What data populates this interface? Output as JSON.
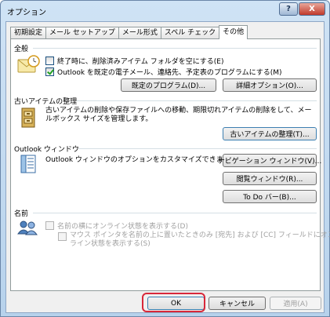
{
  "window": {
    "title": "オプション",
    "help_label": "?",
    "close_label": "X"
  },
  "tabs": [
    {
      "label": "初期設定",
      "active": false
    },
    {
      "label": "メール セットアップ",
      "active": false
    },
    {
      "label": "メール形式",
      "active": false
    },
    {
      "label": "スペル チェック",
      "active": false
    },
    {
      "label": "その他",
      "active": true
    }
  ],
  "general": {
    "title": "全般",
    "empty_deleted_label": "終了時に、削除済みアイテム フォルダを空にする(E)",
    "empty_deleted_checked": false,
    "default_program_label": "Outlook を既定の電子メール、連絡先、予定表のプログラムにする(M)",
    "default_program_checked": true,
    "default_programs_button": "既定のプログラム(D)...",
    "advanced_options_button": "詳細オプション(O)..."
  },
  "autoarchive": {
    "title": "古いアイテムの整理",
    "description": "古いアイテムの削除や保存ファイルへの移動、期限切れアイテムの削除をして、メールボックス サイズを管理します。",
    "button": "古いアイテムの整理(T)..."
  },
  "outlook_panes": {
    "title": "Outlook ウィンドウ",
    "description": "Outlook ウィンドウのオプションをカスタマイズできます。",
    "navigation_button": "ナビゲーション ウィンドウ(V)...",
    "reading_button": "閲覧ウィンドウ(R)...",
    "todo_button": "To Do バー(B)..."
  },
  "names": {
    "title": "名前",
    "online_status_label": "名前の横にオンライン状態を表示する(D)",
    "hover_label_line1": "マウス ポインタを名前の上に置いたときのみ [宛先] および [CC] フィールドにオン",
    "hover_label_line2": "ライン状態を表示する(S)"
  },
  "footer": {
    "ok": "OK",
    "cancel": "キャンセル",
    "apply": "適用(A)"
  }
}
